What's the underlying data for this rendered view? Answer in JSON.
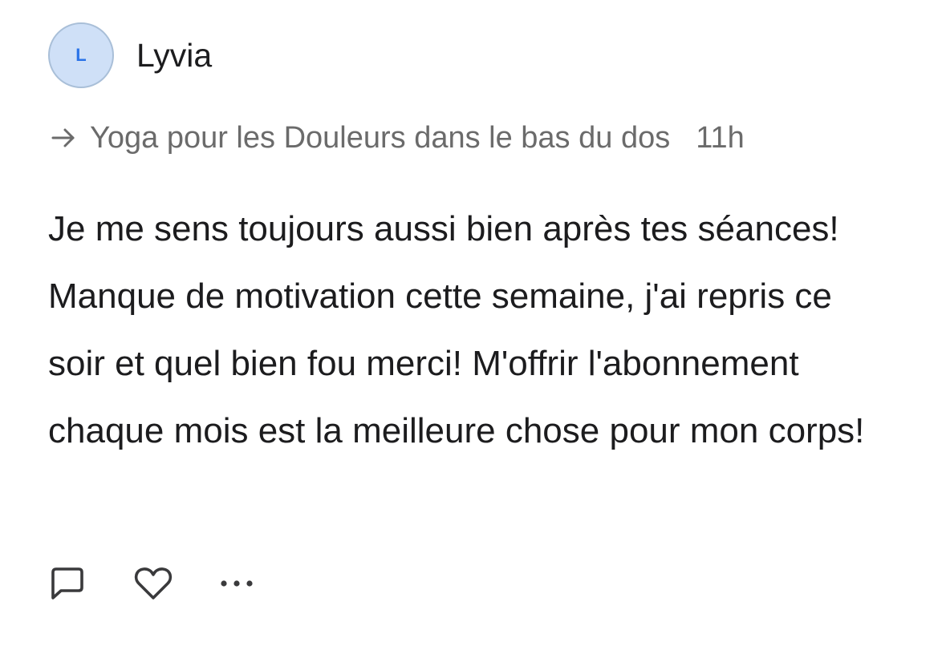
{
  "author": {
    "initial": "L",
    "name": "Lyvia"
  },
  "context": {
    "link_text": "Yoga pour les Douleurs dans le bas du dos",
    "timestamp": "11h"
  },
  "comment_text": "Je me sens toujours aussi bien après tes séances! Manque de motivation cette semaine, j'ai repris ce soir et quel bien fou merci! M'offrir l'abonnement chaque mois est la meilleure chose pour mon corps!",
  "actions": {
    "reply_icon": "speech-bubble-icon",
    "like_icon": "heart-icon",
    "more_icon": "ellipsis-icon"
  },
  "colors": {
    "avatar_bg": "#cfe0f7",
    "avatar_letter": "#2a73e8",
    "muted_text": "#6b6b6b",
    "icon_stroke": "#3a3a3c"
  }
}
